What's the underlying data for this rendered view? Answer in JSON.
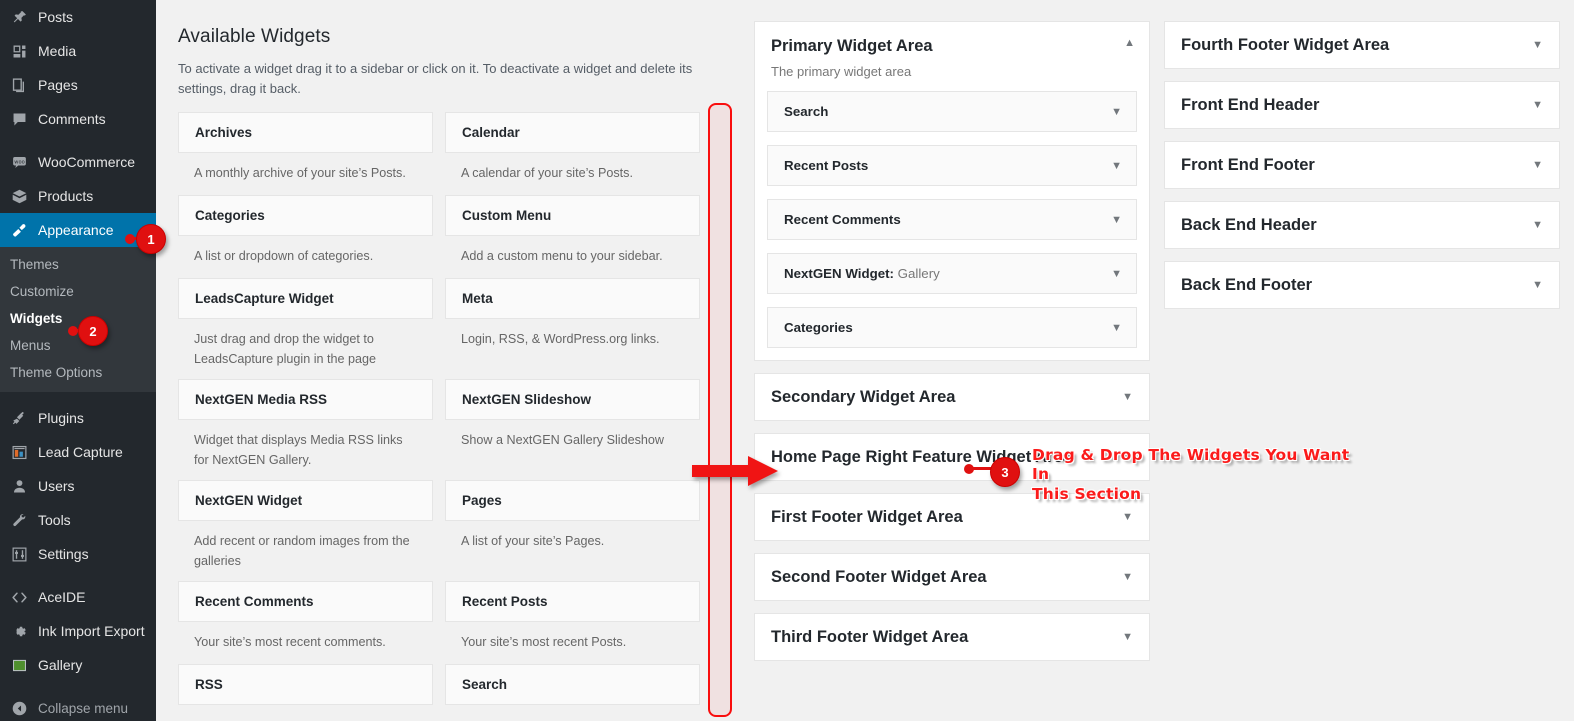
{
  "sidebar": {
    "items": [
      {
        "label": "Posts",
        "icon": "pin-icon",
        "active": false
      },
      {
        "label": "Media",
        "icon": "media-icon",
        "active": false
      },
      {
        "label": "Pages",
        "icon": "pages-icon",
        "active": false
      },
      {
        "label": "Comments",
        "icon": "comments-icon",
        "active": false
      },
      {
        "label": "WooCommerce",
        "icon": "woocommerce-icon",
        "active": false
      },
      {
        "label": "Products",
        "icon": "products-box-icon",
        "active": false
      },
      {
        "label": "Appearance",
        "icon": "paintbrush-icon",
        "active": true
      },
      {
        "label": "Plugins",
        "icon": "plug-icon",
        "active": false
      },
      {
        "label": "Lead Capture",
        "icon": "lead-capture-icon",
        "active": false
      },
      {
        "label": "Users",
        "icon": "user-icon",
        "active": false
      },
      {
        "label": "Tools",
        "icon": "wrench-icon",
        "active": false
      },
      {
        "label": "Settings",
        "icon": "sliders-icon",
        "active": false
      },
      {
        "label": "AceIDE",
        "icon": "code-brackets-icon",
        "active": false
      },
      {
        "label": "Ink Import Export",
        "icon": "gear-icon",
        "active": false
      },
      {
        "label": "Gallery",
        "icon": "gallery-square-icon",
        "active": false
      }
    ],
    "submenu": [
      {
        "label": "Themes",
        "current": false
      },
      {
        "label": "Customize",
        "current": false
      },
      {
        "label": "Widgets",
        "current": true
      },
      {
        "label": "Menus",
        "current": false
      },
      {
        "label": "Theme Options",
        "current": false
      }
    ],
    "collapse": {
      "label": "Collapse menu",
      "icon": "collapse-arrow-icon"
    }
  },
  "available": {
    "title": "Available Widgets",
    "description": "To activate a widget drag it to a sidebar or click on it. To deactivate a widget and delete its settings, drag it back.",
    "widgets": [
      {
        "name": "Archives",
        "desc": "A monthly archive of your site’s Posts."
      },
      {
        "name": "Calendar",
        "desc": "A calendar of your site’s Posts."
      },
      {
        "name": "Categories",
        "desc": "A list or dropdown of categories."
      },
      {
        "name": "Custom Menu",
        "desc": "Add a custom menu to your sidebar."
      },
      {
        "name": "LeadsCapture Widget",
        "desc": "Just drag and drop the widget to LeadsCapture plugin in the page"
      },
      {
        "name": "Meta",
        "desc": "Login, RSS, & WordPress.org links."
      },
      {
        "name": "NextGEN Media RSS",
        "desc": "Widget that displays Media RSS links for NextGEN Gallery."
      },
      {
        "name": "NextGEN Slideshow",
        "desc": "Show a NextGEN Gallery Slideshow"
      },
      {
        "name": "NextGEN Widget",
        "desc": "Add recent or random images from the galleries"
      },
      {
        "name": "Pages",
        "desc": "A list of your site’s Pages."
      },
      {
        "name": "Recent Comments",
        "desc": "Your site’s most recent comments."
      },
      {
        "name": "Recent Posts",
        "desc": "Your site’s most recent Posts."
      },
      {
        "name": "RSS",
        "desc": ""
      },
      {
        "name": "Search",
        "desc": ""
      }
    ]
  },
  "middle_column": {
    "primary": {
      "title": "Primary Widget Area",
      "subtitle": "The primary widget area",
      "toggle_icon": "chevron-up-icon",
      "widgets": [
        {
          "label": "Search",
          "sub": "",
          "caret": "chevron-down-icon"
        },
        {
          "label": "Recent Posts",
          "sub": "",
          "caret": "chevron-down-icon"
        },
        {
          "label": "Recent Comments",
          "sub": "",
          "caret": "chevron-down-icon"
        },
        {
          "label": "NextGEN Widget:",
          "sub": " Gallery",
          "caret": "chevron-down-icon"
        },
        {
          "label": "Categories",
          "sub": "",
          "caret": "chevron-down-icon"
        }
      ]
    },
    "collapsed_areas": [
      {
        "title": "Secondary Widget Area",
        "caret": "chevron-down-icon"
      },
      {
        "title": "Home Page Right Feature Widget Area",
        "caret": "chevron-down-icon"
      },
      {
        "title": "First Footer Widget Area",
        "caret": "chevron-down-icon"
      },
      {
        "title": "Second Footer Widget Area",
        "caret": "chevron-down-icon"
      },
      {
        "title": "Third Footer Widget Area",
        "caret": "chevron-down-icon"
      }
    ]
  },
  "right_column": {
    "collapsed_areas": [
      {
        "title": "Fourth Footer Widget Area",
        "caret": "chevron-down-icon"
      },
      {
        "title": "Front End Header",
        "caret": "chevron-down-icon"
      },
      {
        "title": "Front End Footer",
        "caret": "chevron-down-icon"
      },
      {
        "title": "Back End Header",
        "caret": "chevron-down-icon"
      },
      {
        "title": "Back End Footer",
        "caret": "chevron-down-icon"
      }
    ]
  },
  "annotations": {
    "badge1": "1",
    "badge2": "2",
    "badge3": "3",
    "callout_text": "Drag & Drop The Widgets You Want In\nThis Section",
    "accent_color": "#e01010",
    "text_color": "#fb1b1b",
    "highlight_color": "#0073aa"
  }
}
